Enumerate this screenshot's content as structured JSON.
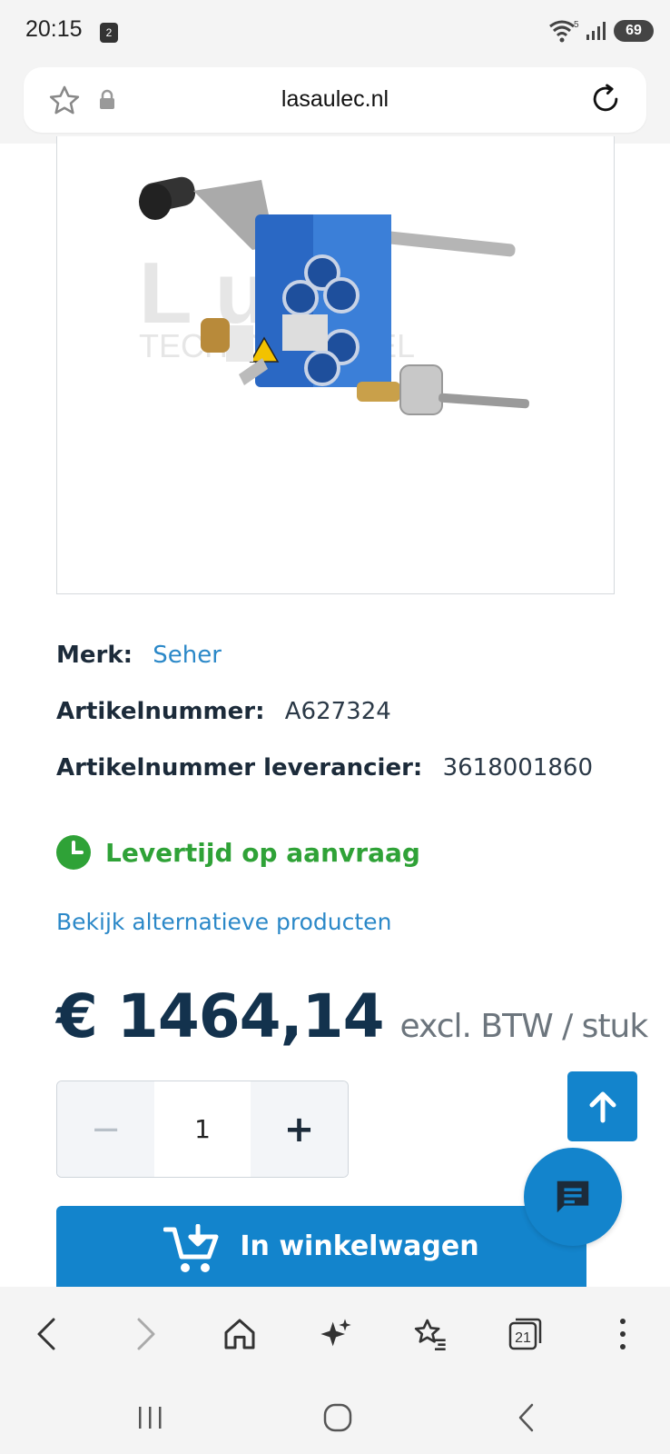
{
  "status_bar": {
    "time": "20:15",
    "notification_count": "2",
    "wifi_label": "5",
    "battery": "69"
  },
  "browser": {
    "url": "lasaulec.nl"
  },
  "product": {
    "image_watermark_top": "L   ulec",
    "image_watermark_bottom": "TECH           OTHANDEL",
    "brand_label": "Merk:",
    "brand_value": "Seher",
    "article_label": "Artikelnummer:",
    "article_value": "A627324",
    "supplier_article_label": "Artikelnummer leverancier:",
    "supplier_article_value": "3618001860",
    "delivery_text": "Levertijd op aanvraag",
    "alternatives_link": "Bekijk alternatieve producten",
    "price": "€ 1464,14",
    "price_suffix": "excl. BTW / stuk",
    "quantity": "1",
    "qty_minus": "−",
    "qty_plus": "+",
    "add_to_cart": "In winkelwagen"
  },
  "toolbar": {
    "tabs_count": "21"
  },
  "colors": {
    "primary": "#1384cc",
    "link": "#2b88c8",
    "delivery_green": "#2fa237",
    "price_navy": "#13324d"
  }
}
